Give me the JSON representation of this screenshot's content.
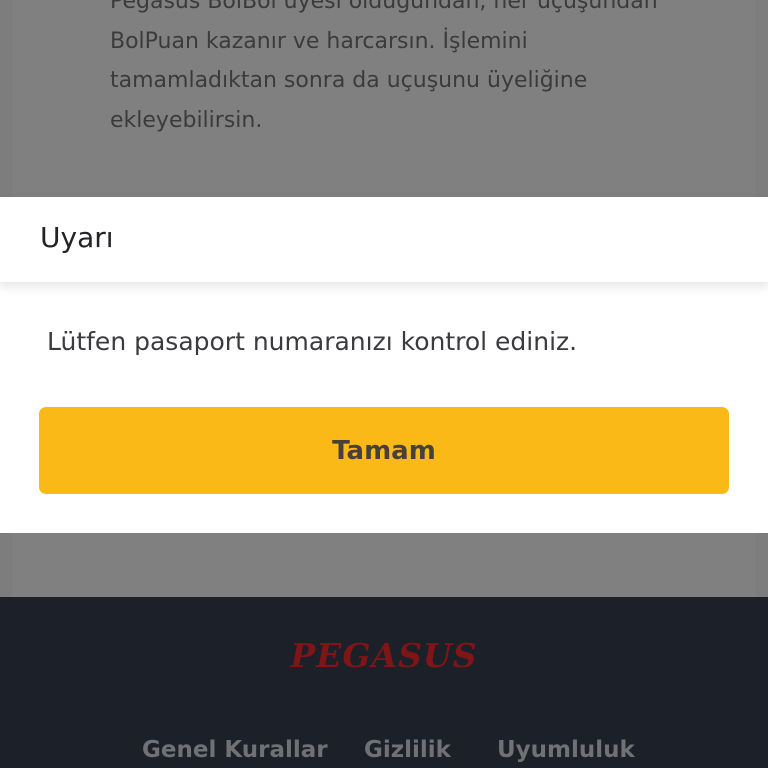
{
  "background": {
    "paragraph_lines": [
      "Pegasus BolBol üyesi olduğundan, her uçuşundan",
      "BolPuan kazanır ve harcarsın. İşlemini",
      "tamamladıktan sonra da uçuşunu üyeliğine",
      "ekleyebilirsin."
    ]
  },
  "modal": {
    "title": "Uyarı",
    "message": "Lütfen pasaport numaranızı kontrol ediniz.",
    "ok_label": "Tamam"
  },
  "footer": {
    "logo_text": "PEGASUS",
    "links": [
      "Genel Kurallar",
      "Gizlilik",
      "Uyumluluk"
    ]
  },
  "colors": {
    "accent": "#fbb917",
    "footer_bg": "#1c2029",
    "logo_red": "#7e1517",
    "overlay": "#7d7d7e"
  }
}
